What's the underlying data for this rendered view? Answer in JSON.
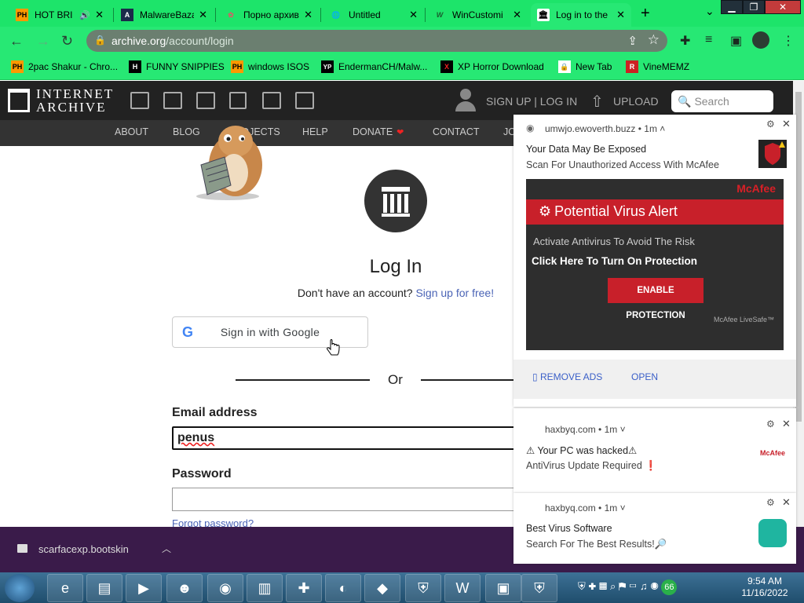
{
  "browser": {
    "tabs": [
      {
        "title": "HOT BRI",
        "favicon": "PH",
        "audio": true
      },
      {
        "title": "MalwareBaza",
        "favicon": "A"
      },
      {
        "title": "Порно архив",
        "favicon": "✿"
      },
      {
        "title": "Untitled",
        "favicon": "🌐"
      },
      {
        "title": "WinCustomi",
        "favicon": "W"
      },
      {
        "title": "Log in to the",
        "favicon": "🏛",
        "active": true
      }
    ],
    "url_host": "archive.org",
    "url_path": "/account/login",
    "bookmarks": [
      {
        "label": "2pac Shakur - Chro...",
        "icon": "PH"
      },
      {
        "label": "FUNNY SNIPPIES",
        "icon": "H"
      },
      {
        "label": "windows ISOS",
        "icon": "PH"
      },
      {
        "label": "EndermanCH/Malw...",
        "icon": "YP"
      },
      {
        "label": "XP Horror Download",
        "icon": "X"
      },
      {
        "label": "New Tab",
        "icon": "🔒"
      },
      {
        "label": "VineMEMZ",
        "icon": "R"
      }
    ]
  },
  "ia": {
    "logo_line1": "INTERNET",
    "logo_line2": "ARCHIVE",
    "signup_login": "SIGN UP | LOG IN",
    "upload": "UPLOAD",
    "search_placeholder": "Search",
    "nav": [
      "ABOUT",
      "BLOG",
      "PROJECTS",
      "HELP",
      "DONATE",
      "CONTACT",
      "JOBS"
    ]
  },
  "login": {
    "title": "Log In",
    "no_account": "Don't have an account?",
    "signup_link": "Sign up for free",
    "signup_punct": "!",
    "google_button": "Sign in with Google",
    "or": "Or",
    "email_label": "Email address",
    "email_value": "penus",
    "password_label": "Password",
    "forgot": "Forgot password?"
  },
  "download": {
    "filename": "scarfacexp.bootskin"
  },
  "notifications": [
    {
      "source": "umwjo.ewoverth.buzz",
      "age": "1m",
      "title": "Your Data May Be Exposed",
      "body": "Scan For Unauthorized Access With McAfee",
      "banner": {
        "brand": "McAfee",
        "alert": "Potential Virus Alert",
        "line1": "Activate Antivirus To Avoid The Risk",
        "line2": "Click Here To Turn On Protection",
        "button": "ENABLE PROTECTION",
        "footer": "McAfee LiveSafe™"
      },
      "actions": [
        "REMOVE ADS",
        "OPEN"
      ]
    },
    {
      "source": "haxbyq.com",
      "age": "1m",
      "title": "⚠ Your PC was hacked⚠",
      "body": "AntiVirus Update Required ❗",
      "thumb_label": "McAfee"
    },
    {
      "source": "haxbyq.com",
      "age": "1m",
      "title": "Best Virus Software",
      "body": "Search For The Best Results!🔎"
    }
  ],
  "taskbar": {
    "time": "9:54 AM",
    "date": "11/16/2022",
    "badge": "66"
  },
  "colors": {
    "browser_green": "#27e874",
    "mcafee_red": "#c8202a",
    "ia_dark": "#222222"
  }
}
